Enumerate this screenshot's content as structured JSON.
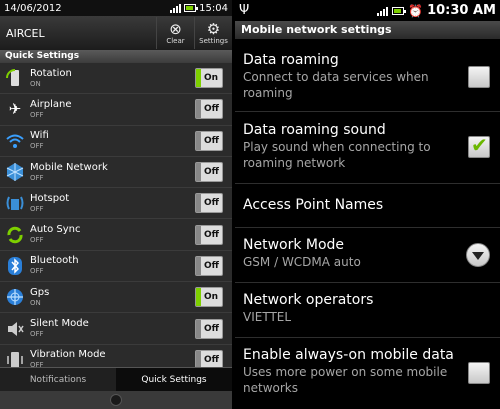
{
  "left": {
    "statusbar": {
      "date": "14/06/2012",
      "time": "15:04"
    },
    "header": {
      "carrier": "AIRCEL",
      "clear_label": "Clear",
      "settings_label": "Settings"
    },
    "section_title": "Quick Settings",
    "items": [
      {
        "name": "Rotation",
        "state": "ON",
        "toggle": "On",
        "icon": "rotation-icon"
      },
      {
        "name": "Airplane",
        "state": "OFF",
        "toggle": "Off",
        "icon": "airplane-icon"
      },
      {
        "name": "Wifi",
        "state": "OFF",
        "toggle": "Off",
        "icon": "wifi-icon"
      },
      {
        "name": "Mobile Network",
        "state": "OFF",
        "toggle": "Off",
        "icon": "mobile-network-icon"
      },
      {
        "name": "Hotspot",
        "state": "OFF",
        "toggle": "Off",
        "icon": "hotspot-icon"
      },
      {
        "name": "Auto Sync",
        "state": "OFF",
        "toggle": "Off",
        "icon": "sync-icon"
      },
      {
        "name": "Bluetooth",
        "state": "OFF",
        "toggle": "Off",
        "icon": "bluetooth-icon"
      },
      {
        "name": "Gps",
        "state": "ON",
        "toggle": "On",
        "icon": "gps-icon"
      },
      {
        "name": "Silent Mode",
        "state": "OFF",
        "toggle": "Off",
        "icon": "speaker-icon"
      },
      {
        "name": "Vibration Mode",
        "state": "OFF",
        "toggle": "Off",
        "icon": "vibration-icon"
      }
    ],
    "tabs": {
      "notifications": "Notifications",
      "quick_settings": "Quick Settings"
    }
  },
  "right": {
    "statusbar": {
      "time": "10:30 AM"
    },
    "title": "Mobile network settings",
    "prefs": [
      {
        "title": "Data roaming",
        "summary": "Connect to data services when roaming",
        "widget": "checkbox",
        "checked": false
      },
      {
        "title": "Data roaming sound",
        "summary": "Play sound when connecting to roaming network",
        "widget": "checkbox",
        "checked": true
      },
      {
        "title": "Access Point Names",
        "summary": "",
        "widget": "none"
      },
      {
        "title": "Network Mode",
        "summary": "GSM / WCDMA auto",
        "widget": "dropdown"
      },
      {
        "title": "Network operators",
        "summary": "VIETTEL",
        "widget": "none"
      },
      {
        "title": "Enable always-on mobile data",
        "summary": "Uses more power on some mobile networks",
        "widget": "checkbox",
        "checked": false
      }
    ]
  },
  "colors": {
    "accent_green": "#7ed000",
    "checkmark_green": "#6ab700"
  }
}
